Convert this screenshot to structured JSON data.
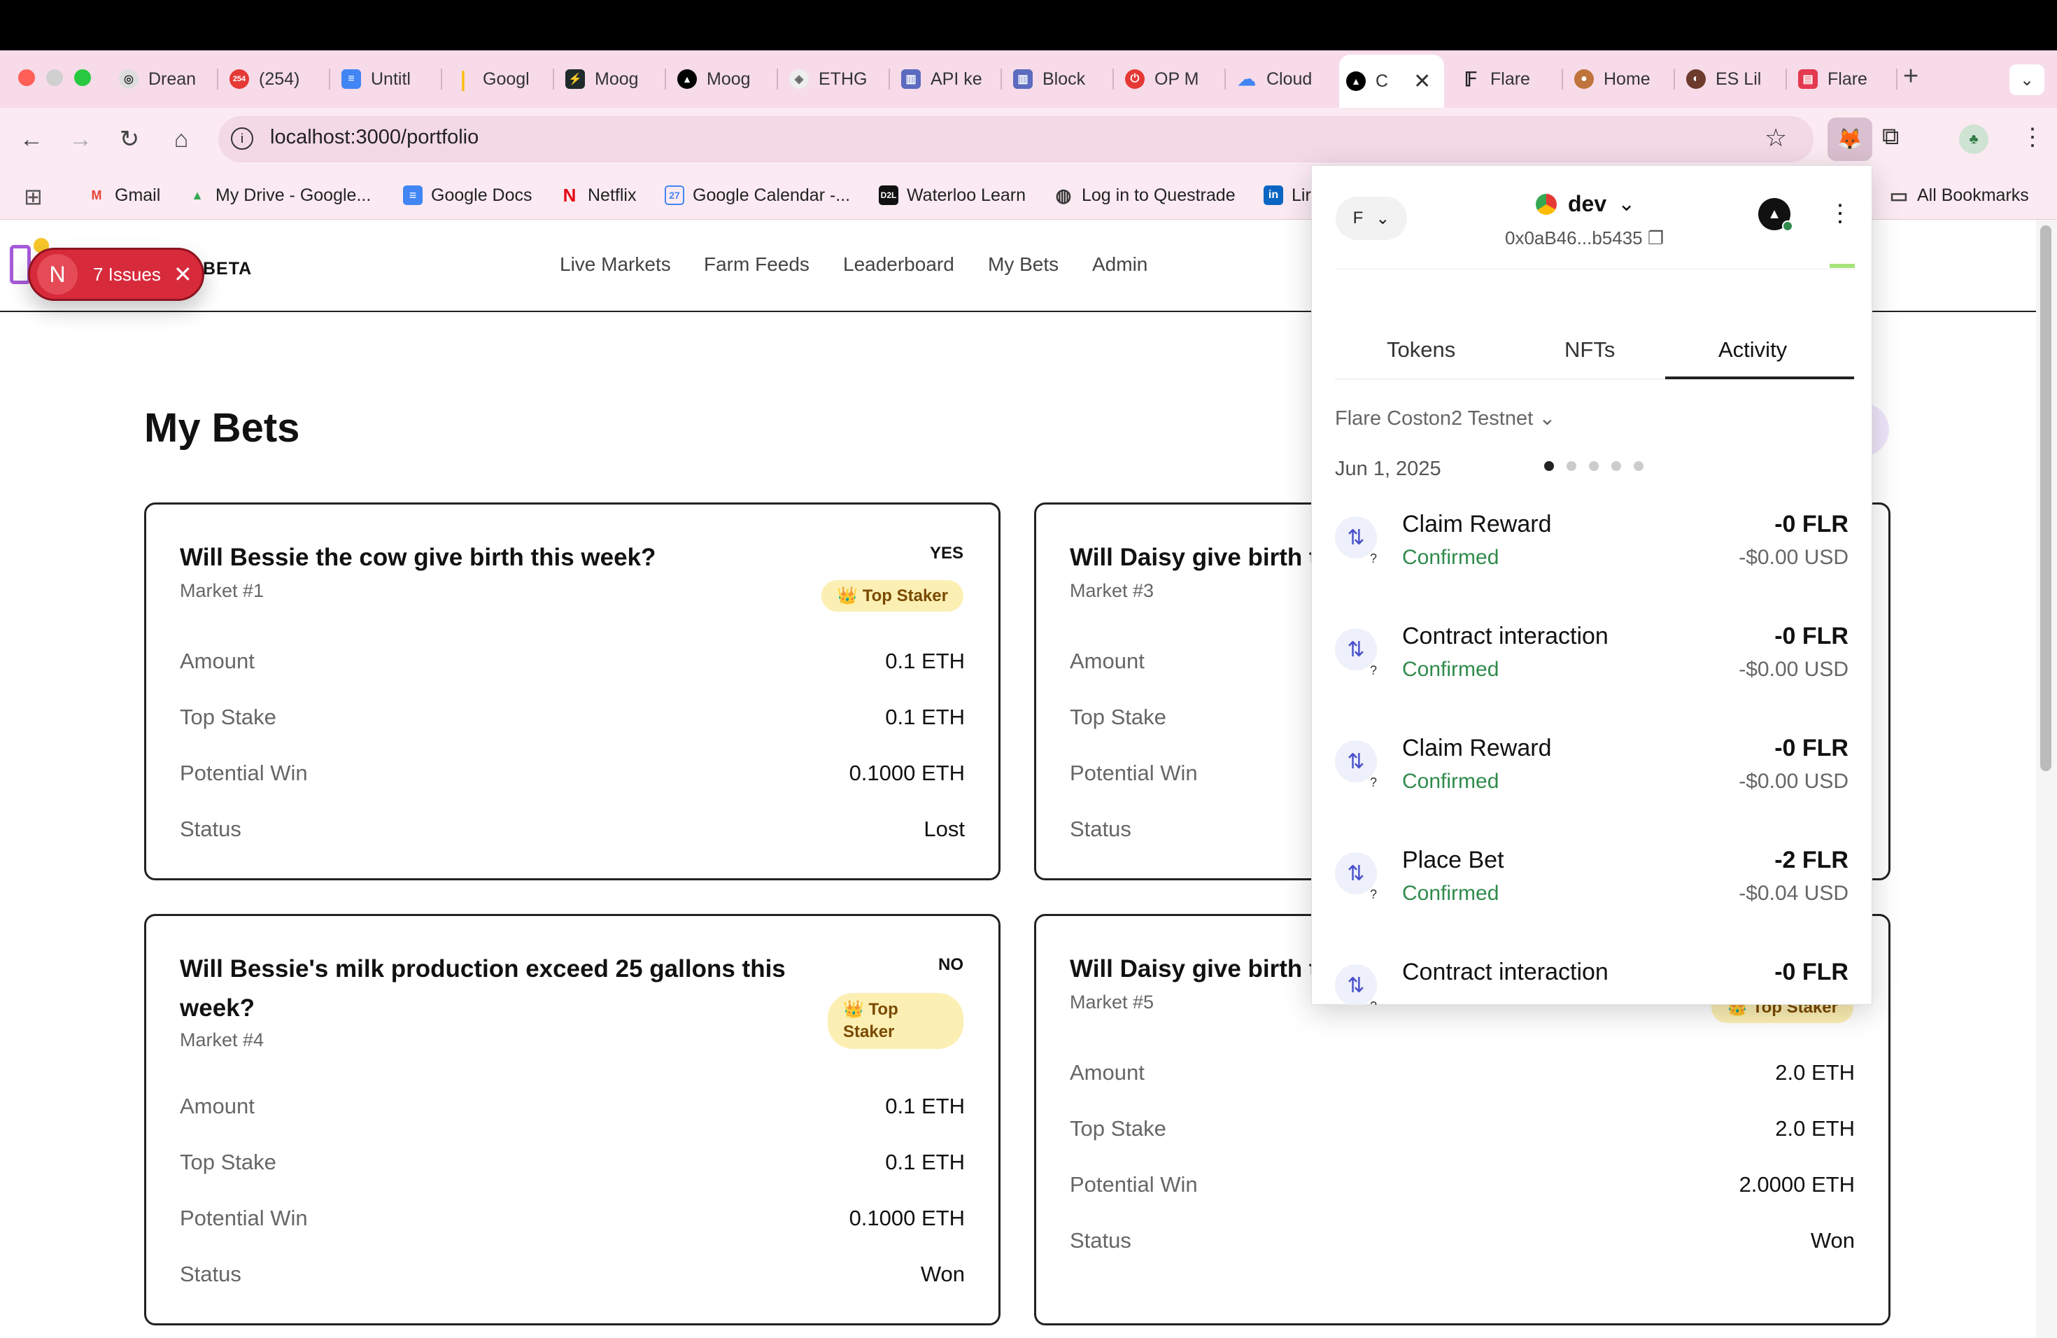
{
  "browser": {
    "tabs": [
      {
        "title": "Drean",
        "icon": "dream-icon",
        "color": "#888"
      },
      {
        "title": "(254)",
        "icon": "youtube-icon",
        "color": "#e53935"
      },
      {
        "title": "Untitl",
        "icon": "docs-icon",
        "color": "#4285f4"
      },
      {
        "title": "Googl",
        "icon": "google-icon",
        "color": "#fbbc05"
      },
      {
        "title": "Moog",
        "icon": "moog-icon",
        "color": "#222"
      },
      {
        "title": "Moog",
        "icon": "triangle-icon",
        "color": "#000"
      },
      {
        "title": "ETHG",
        "icon": "ethg-icon",
        "color": "#999"
      },
      {
        "title": "API ke",
        "icon": "api-icon",
        "color": "#5c6bc0"
      },
      {
        "title": "Block",
        "icon": "block-icon",
        "color": "#5c6bc0"
      },
      {
        "title": "OP M",
        "icon": "op-icon",
        "color": "#e53935"
      },
      {
        "title": "Cloud",
        "icon": "cloud-icon",
        "color": "#4285f4"
      },
      {
        "title": "C",
        "icon": "triangle-icon",
        "color": "#000"
      },
      {
        "title": "Flare",
        "icon": "flare-icon",
        "color": "#222"
      },
      {
        "title": "Home",
        "icon": "home-tab-icon",
        "color": "#c0733a"
      },
      {
        "title": "ES Lil",
        "icon": "es-icon",
        "color": "#6d3b2b"
      },
      {
        "title": "Flare",
        "icon": "flare-red-icon",
        "color": "#e53950"
      }
    ],
    "youtube_badge": "254",
    "url": "localhost:3000/portfolio",
    "bookmarks": [
      "Gmail",
      "My Drive - Google...",
      "Google Docs",
      "Netflix",
      "Google Calendar -...",
      "Waterloo Learn",
      "Log in to Questrade",
      "Lir"
    ],
    "all_bookmarks": "All Bookmarks"
  },
  "app": {
    "beta": "BETA",
    "issues": {
      "letter": "N",
      "label": "7 Issues"
    },
    "nav": [
      "Live Markets",
      "Farm Feeds",
      "Leaderboard",
      "My Bets",
      "Admin"
    ],
    "page_title": "My Bets",
    "row_labels": {
      "amount": "Amount",
      "top_stake": "Top Stake",
      "potential_win": "Potential Win",
      "status": "Status"
    },
    "cards": [
      {
        "question": "Will Bessie the cow give birth this week?",
        "market": "Market #1",
        "side": "YES",
        "badge": "👑 Top Staker",
        "amount": "0.1 ETH",
        "top_stake": "0.1 ETH",
        "potential_win": "0.1000 ETH",
        "status": "Lost"
      },
      {
        "question": "Will Daisy give birth t",
        "market": "Market #3",
        "side": "",
        "badge": "",
        "amount": "",
        "top_stake": "",
        "potential_win": "",
        "status": ""
      },
      {
        "question": "Will Bessie's milk production exceed 25 gallons this week?",
        "market": "Market #4",
        "side": "NO",
        "badge_line1": "👑 Top",
        "badge_line2": "Staker",
        "amount": "0.1 ETH",
        "top_stake": "0.1 ETH",
        "potential_win": "0.1000 ETH",
        "status": "Won"
      },
      {
        "question": "Will Daisy give birth t",
        "market": "Market #5",
        "side": "",
        "badge": "👑 Top Staker",
        "amount": "2.0 ETH",
        "top_stake": "2.0 ETH",
        "potential_win": "2.0000 ETH",
        "status": "Won"
      }
    ]
  },
  "wallet": {
    "account": "F",
    "network": "dev",
    "address": "0x0aB46...b5435",
    "tabs": [
      "Tokens",
      "NFTs",
      "Activity"
    ],
    "active_tab": "Activity",
    "chain": "Flare Coston2 Testnet",
    "date": "Jun 1, 2025",
    "activity": [
      {
        "name": "Claim Reward",
        "status": "Confirmed",
        "amount": "-0 FLR",
        "usd": "-$0.00 USD"
      },
      {
        "name": "Contract interaction",
        "status": "Confirmed",
        "amount": "-0 FLR",
        "usd": "-$0.00 USD"
      },
      {
        "name": "Claim Reward",
        "status": "Confirmed",
        "amount": "-0 FLR",
        "usd": "-$0.00 USD"
      },
      {
        "name": "Place Bet",
        "status": "Confirmed",
        "amount": "-2 FLR",
        "usd": "-$0.04 USD"
      },
      {
        "name": "Contract interaction",
        "status": "",
        "amount": "-0 FLR",
        "usd": ""
      }
    ],
    "status_color": "#2f8b4c"
  }
}
